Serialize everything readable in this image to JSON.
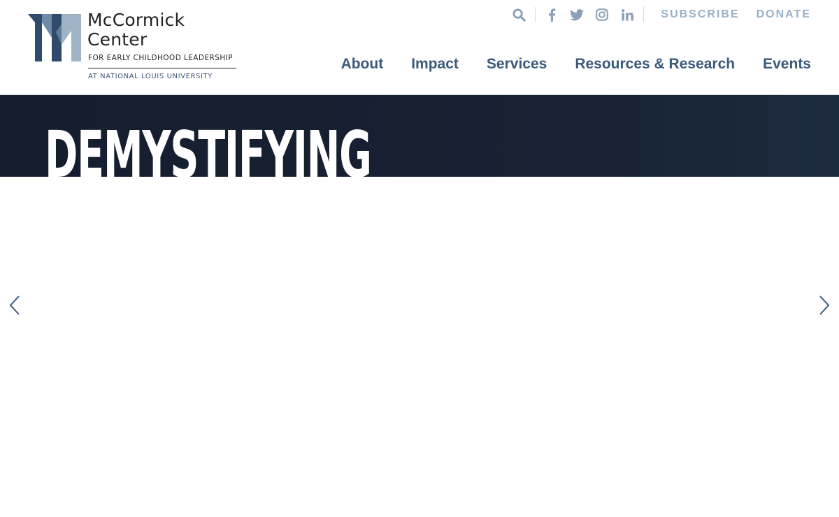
{
  "brand": {
    "name_line1": "McCormick",
    "name_line2": "Center",
    "subtitle": "FOR EARLY CHILDHOOD LEADERSHIP",
    "university": "AT NATIONAL LOUIS UNIVERSITY",
    "colors": {
      "mark_dark": "#2f4a6b",
      "mark_mid": "#5d7a98",
      "mark_light": "#9fb3c6"
    }
  },
  "utility": {
    "search_icon": "search-icon",
    "social": [
      {
        "name": "facebook-icon"
      },
      {
        "name": "twitter-icon"
      },
      {
        "name": "instagram-icon"
      },
      {
        "name": "linkedin-icon"
      }
    ],
    "subscribe_label": "SUBSCRIBE",
    "donate_label": "DONATE"
  },
  "nav": {
    "items": [
      {
        "label": "About"
      },
      {
        "label": "Impact"
      },
      {
        "label": "Services"
      },
      {
        "label": "Resources & Research"
      },
      {
        "label": "Events"
      }
    ]
  },
  "hero": {
    "title": "DEMYSTIFYING",
    "background": "#172234"
  },
  "carousel": {
    "prev_icon": "chevron-left-icon",
    "next_icon": "chevron-right-icon"
  },
  "colors": {
    "nav_text": "#3a5a7b",
    "utility_text": "#9ab0c6",
    "icon": "#8aa0b6"
  }
}
